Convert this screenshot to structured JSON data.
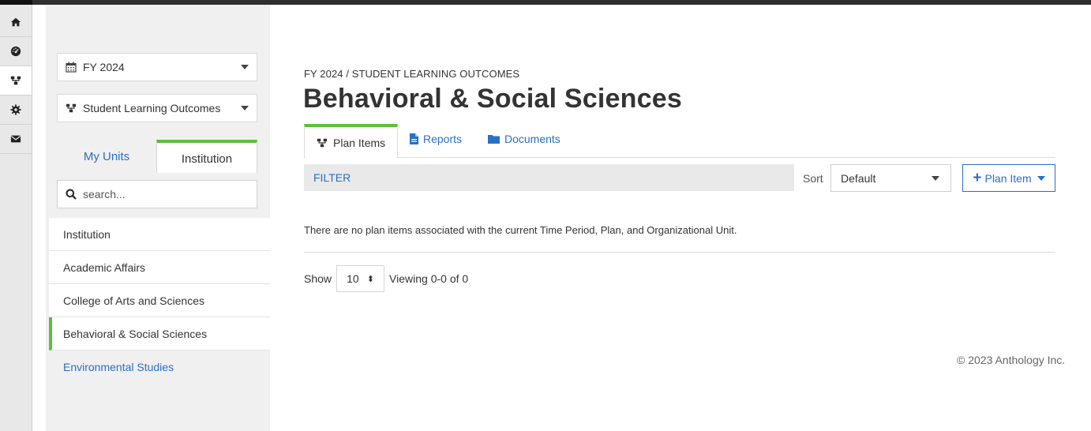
{
  "colors": {
    "accent": "#5cc038",
    "link": "#2a6fc4",
    "panel": "#f0f0f0",
    "topbar": "#2f2f2f"
  },
  "rail": {
    "items": [
      {
        "icon": "home-icon"
      },
      {
        "icon": "dashboard-icon"
      },
      {
        "icon": "sitemap-icon",
        "active": true
      },
      {
        "icon": "gear-icon"
      },
      {
        "icon": "envelope-icon"
      }
    ]
  },
  "left_panel": {
    "fiscal_year": "FY 2024",
    "plan": "Student Learning Outcomes",
    "tabs": {
      "my_units": "My Units",
      "institution": "Institution"
    },
    "search_placeholder": "search...",
    "units": [
      "Institution",
      "Academic Affairs",
      "College of Arts and Sciences",
      "Behavioral & Social Sciences",
      "Environmental Studies"
    ],
    "selected_unit": "Behavioral & Social Sciences"
  },
  "main": {
    "breadcrumb": "FY 2024 / STUDENT LEARNING OUTCOMES",
    "title": "Behavioral & Social Sciences",
    "tabs": {
      "plan_items": "Plan Items",
      "reports": "Reports",
      "documents": "Documents"
    },
    "filter_label": "FILTER",
    "sort_label": "Sort",
    "sort_value": "Default",
    "add_button_label": "Plan Item",
    "empty_message": "There are no plan items associated with the current Time Period, Plan, and Organizational Unit.",
    "pager": {
      "show_label": "Show",
      "page_size": "10",
      "viewing": "Viewing 0-0 of 0"
    }
  },
  "footer": {
    "copyright": "© 2023 Anthology Inc."
  }
}
